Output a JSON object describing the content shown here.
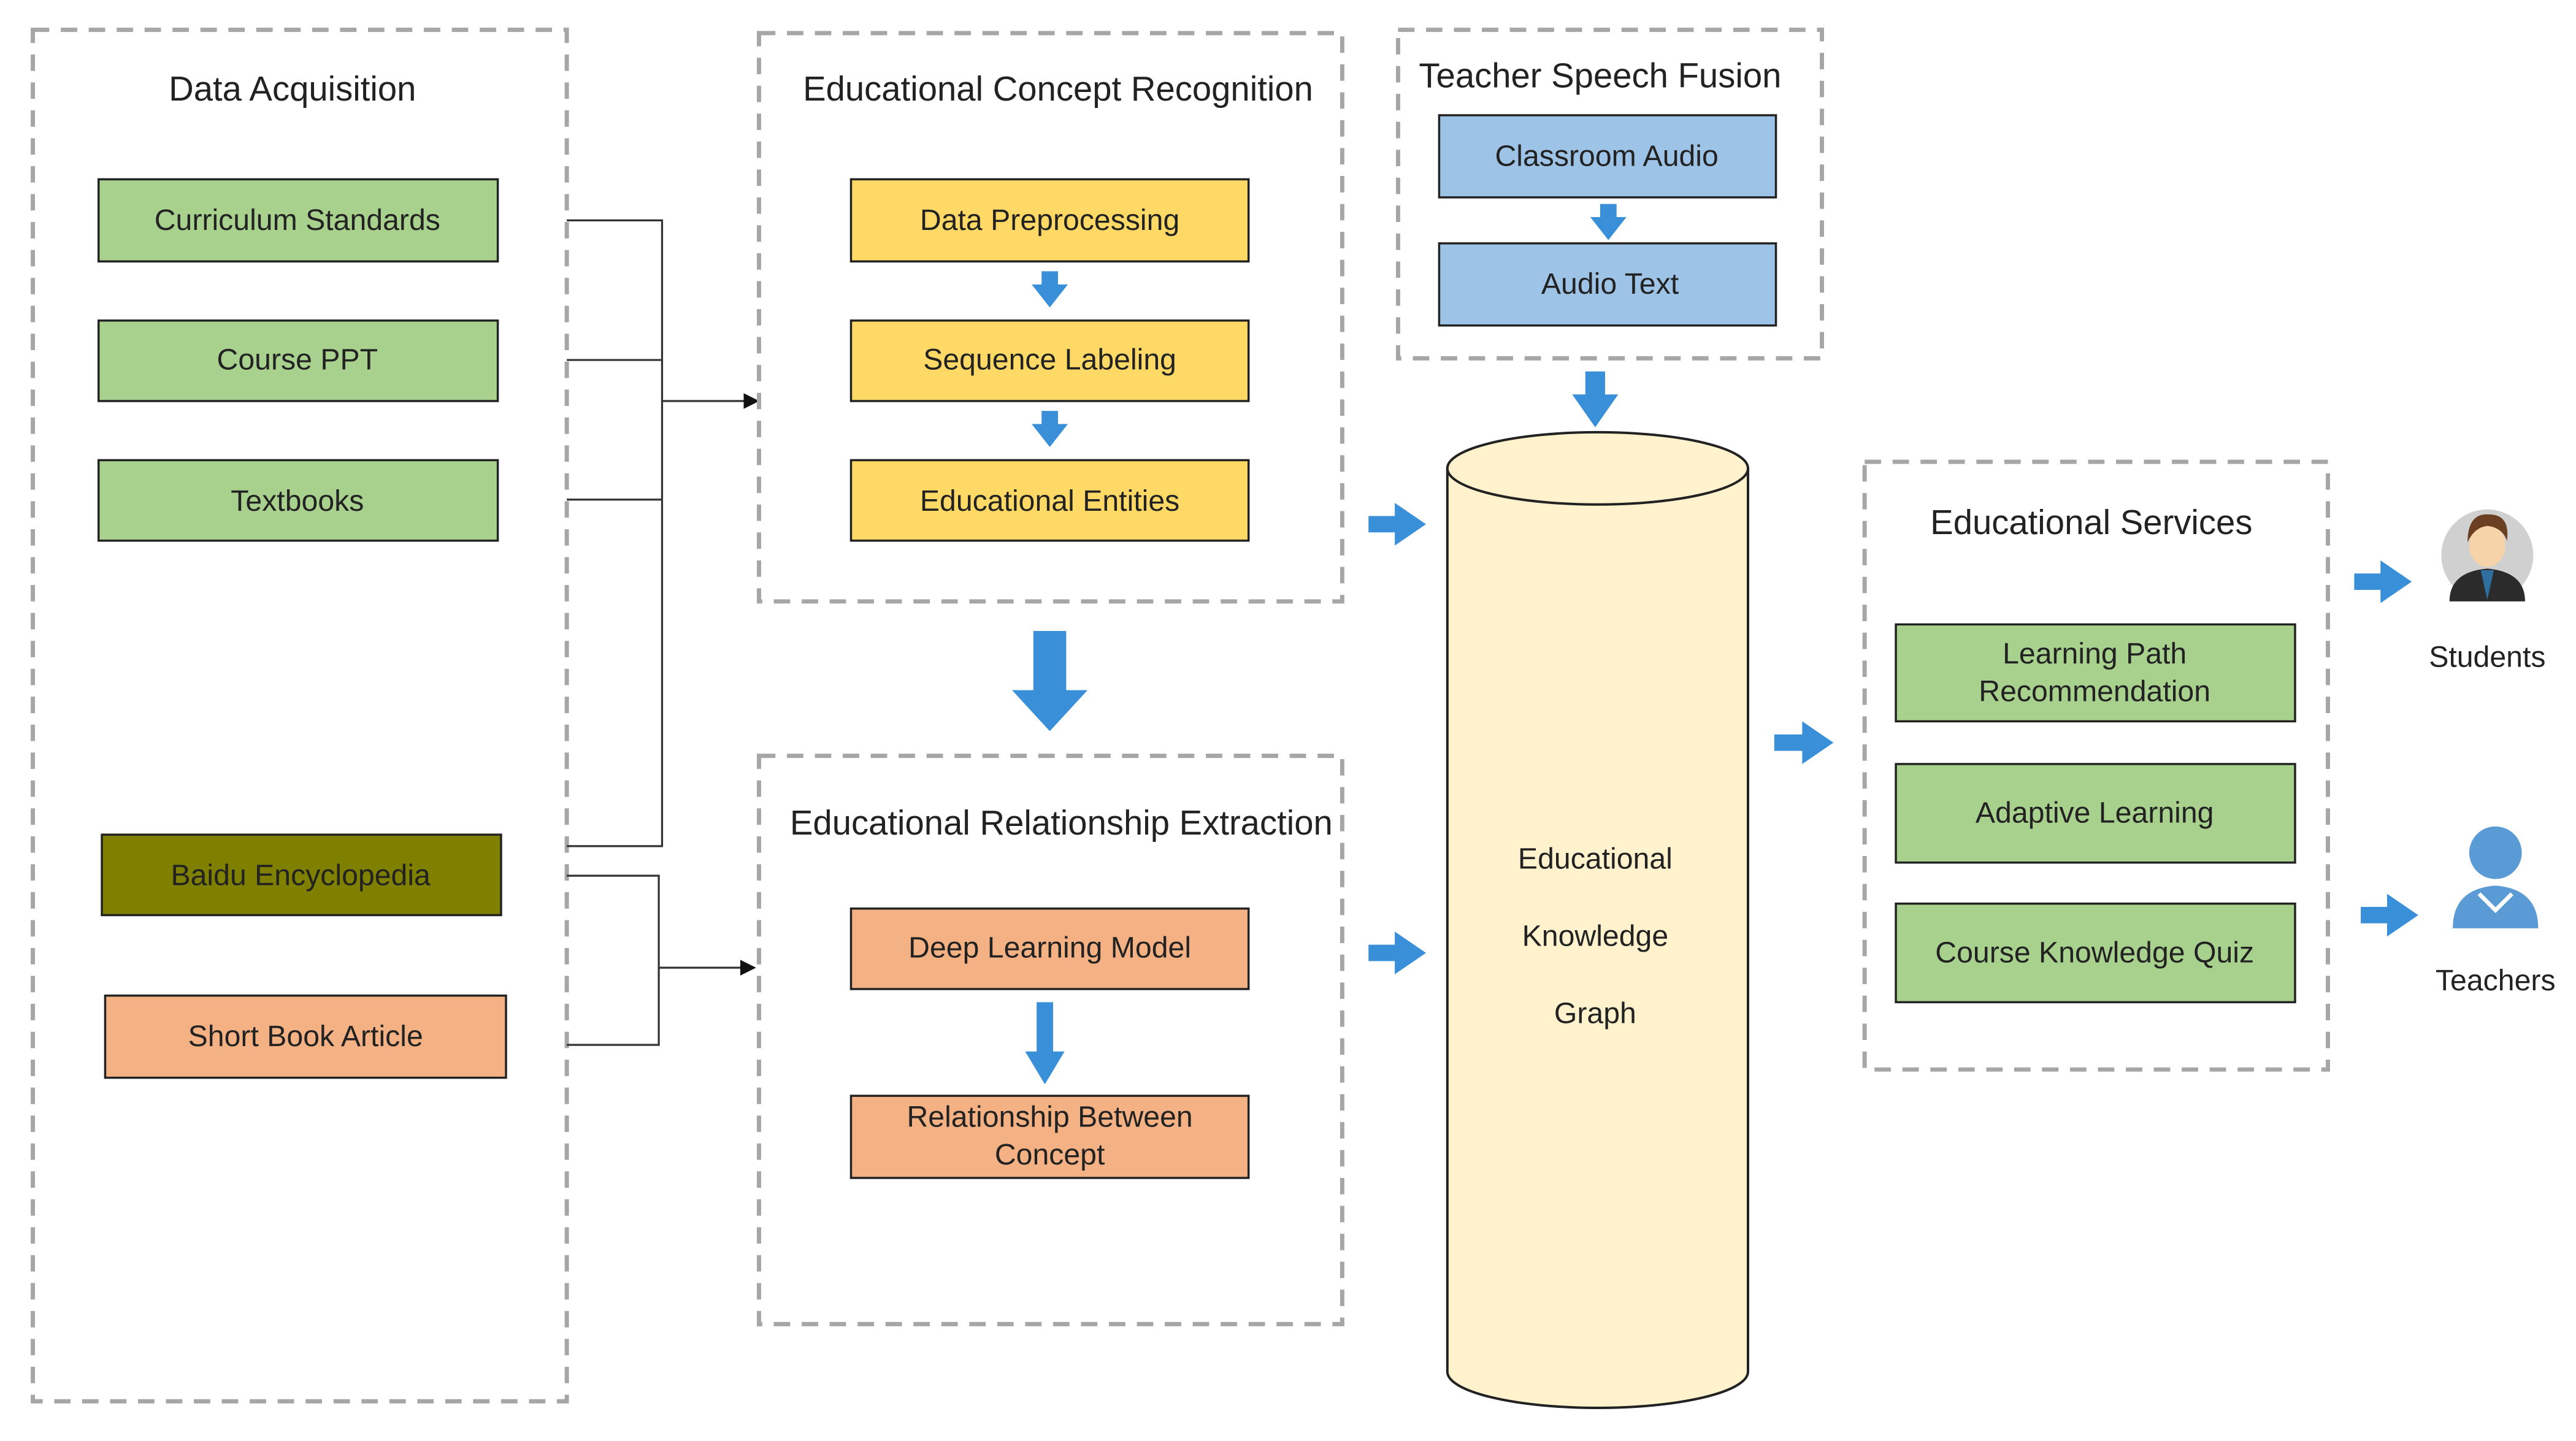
{
  "data_acquisition": {
    "title": "Data Acquisition",
    "items": [
      "Curriculum Standards",
      "Course PPT",
      "Textbooks",
      "Baidu Encyclopedia",
      "Short Book Article"
    ]
  },
  "concept_recognition": {
    "title": "Educational Concept Recognition",
    "items": [
      "Data Preprocessing",
      "Sequence Labeling",
      "Educational Entities"
    ]
  },
  "relationship_extraction": {
    "title": "Educational Relationship Extraction",
    "items": [
      [
        "Deep Learning Model"
      ],
      [
        "Relationship Between",
        "Concept"
      ]
    ]
  },
  "speech_fusion": {
    "title": "Teacher Speech Fusion",
    "items": [
      "Classroom Audio",
      "Audio Text"
    ]
  },
  "knowledge_graph": {
    "lines": [
      "Educational",
      "Knowledge",
      "Graph"
    ]
  },
  "services": {
    "title": "Educational Services",
    "items": [
      [
        "Learning Path",
        "Recommendation"
      ],
      [
        "Adaptive Learning"
      ],
      [
        "Course Knowledge Quiz"
      ]
    ]
  },
  "users": {
    "students": "Students",
    "teachers": "Teachers"
  },
  "colors": {
    "green": "#a9d18e",
    "yellow": "#ffd966",
    "orange": "#f4b183",
    "olive": "#7f7f00",
    "blue_box": "#9dc3e6",
    "arrow": "#3a8fd9",
    "cylinder": "#fff2cc",
    "dash": "#a6a6a6"
  }
}
